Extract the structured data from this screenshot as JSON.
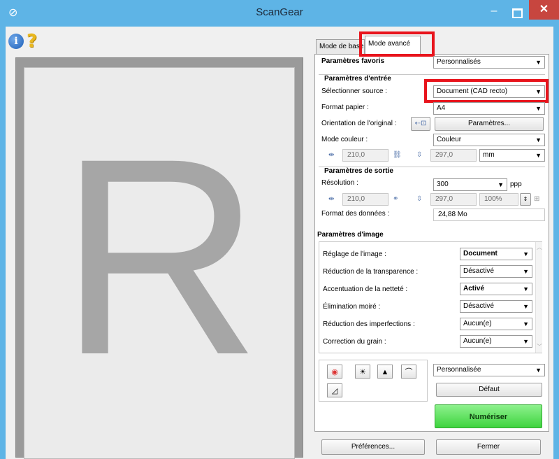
{
  "window": {
    "title": "ScanGear",
    "minimize_glyph": "–",
    "close_glyph": "✕",
    "app_icon": "⊘"
  },
  "toolbar": {
    "info_icon": "i",
    "help_icon": "?"
  },
  "preview": {
    "letter": "R"
  },
  "tabs": {
    "basic": "Mode de base",
    "advanced": "Mode avancé"
  },
  "favorites": {
    "label": "Paramètres favoris",
    "value": "Personnalisés"
  },
  "input": {
    "heading": "Paramètres d'entrée",
    "source_label": "Sélectionner source :",
    "source_value": "Document (CAD recto)",
    "paper_label": "Format papier :",
    "paper_value": "A4",
    "orientation_label": "Orientation de l'original :",
    "orientation_button": "Paramètres...",
    "color_label": "Mode couleur :",
    "color_value": "Couleur",
    "width": "210,0",
    "height": "297,0",
    "unit": "mm"
  },
  "output": {
    "heading": "Paramètres de sortie",
    "resolution_label": "Résolution :",
    "resolution_value": "300",
    "resolution_unit": "ppp",
    "width": "210,0",
    "height": "297,0",
    "scale": "100%",
    "size_label": "Format des données :",
    "size_value": "24,88 Mo"
  },
  "image": {
    "heading": "Paramètres d'image",
    "rows": [
      {
        "label": "Réglage de l'image :",
        "value": "Document",
        "bold": true
      },
      {
        "label": "Réduction de la transparence :",
        "value": "Désactivé",
        "bold": false
      },
      {
        "label": "Accentuation de la netteté :",
        "value": "Activé",
        "bold": true
      },
      {
        "label": "Élimination moiré :",
        "value": "Désactivé",
        "bold": false
      },
      {
        "label": "Réduction des imperfections :",
        "value": "Aucun(e)",
        "bold": false
      },
      {
        "label": "Correction du grain :",
        "value": "Aucun(e)",
        "bold": false
      }
    ]
  },
  "tone": {
    "preset_value": "Personnalisée",
    "default_button": "Défaut"
  },
  "actions": {
    "scan": "Numériser",
    "preferences": "Préférences...",
    "close": "Fermer"
  },
  "colors": {
    "titlebar": "#5eb4e6",
    "highlight": "#e8141c",
    "scan_button": "#4fdc4f",
    "close_button": "#c7463f"
  }
}
